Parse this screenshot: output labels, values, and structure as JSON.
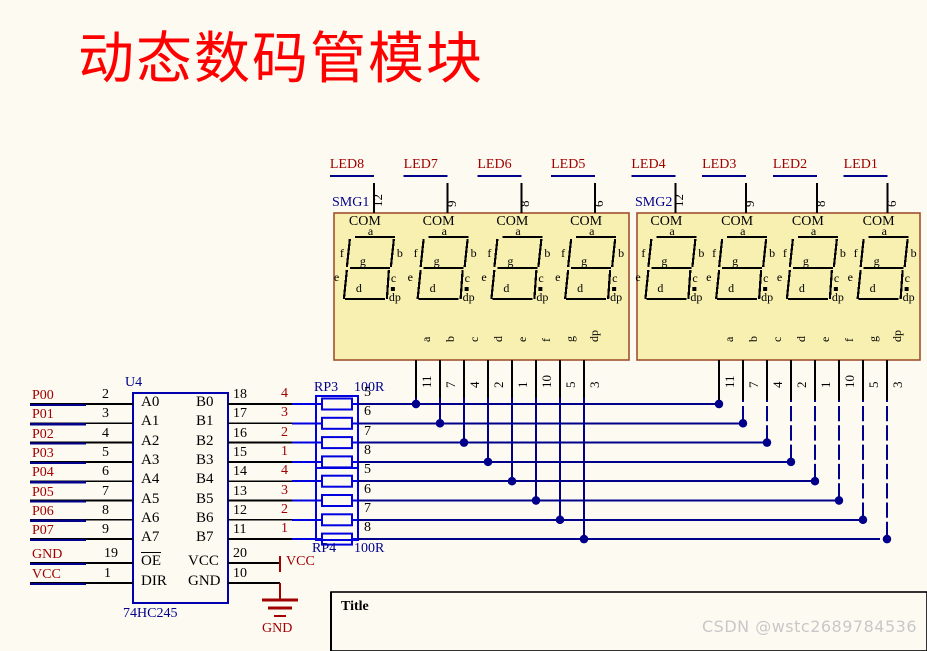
{
  "page": {
    "title_cn": "动态数码管模块",
    "watermark": "CSDN @wstc2689784536",
    "title_block_label": "Title",
    "bg_color": "#fdfaf2",
    "wire_color": "#00008b",
    "pin_line_color": "#000000",
    "label_red": "#a00000",
    "label_blue": "#00008b",
    "display_fill": "#f7f0b0",
    "display_border": "#a05030"
  },
  "displays": [
    {
      "ref": "SMG1",
      "digits": [
        {
          "led_label": "LED8",
          "com_pin": "12",
          "com_label": "COM"
        },
        {
          "led_label": "LED7",
          "com_pin": "9",
          "com_label": "COM"
        },
        {
          "led_label": "LED6",
          "com_pin": "8",
          "com_label": "COM"
        },
        {
          "led_label": "LED5",
          "com_pin": "6",
          "com_label": "COM"
        }
      ],
      "segment_labels": [
        "a",
        "b",
        "c",
        "d",
        "e",
        "f",
        "g",
        "dp"
      ],
      "segment_pins": [
        "11",
        "7",
        "4",
        "2",
        "1",
        "10",
        "5",
        "3"
      ],
      "digit_seg_names": [
        "a",
        "b",
        "c",
        "d",
        "e",
        "f",
        "g",
        "dp"
      ]
    },
    {
      "ref": "SMG2",
      "digits": [
        {
          "led_label": "LED4",
          "com_pin": "12",
          "com_label": "COM"
        },
        {
          "led_label": "LED3",
          "com_pin": "9",
          "com_label": "COM"
        },
        {
          "led_label": "LED2",
          "com_pin": "8",
          "com_label": "COM"
        },
        {
          "led_label": "LED1",
          "com_pin": "6",
          "com_label": "COM"
        }
      ],
      "segment_labels": [
        "a",
        "b",
        "c",
        "d",
        "e",
        "f",
        "g",
        "dp"
      ],
      "segment_pins": [
        "11",
        "7",
        "4",
        "2",
        "1",
        "10",
        "5",
        "3"
      ],
      "digit_seg_names": [
        "a",
        "b",
        "c",
        "d",
        "e",
        "f",
        "g",
        "dp"
      ]
    }
  ],
  "ic": {
    "ref": "U4",
    "part": "74HC245",
    "left_nets": [
      "P00",
      "P01",
      "P02",
      "P03",
      "P04",
      "P05",
      "P06",
      "P07"
    ],
    "left_pins": [
      "2",
      "3",
      "4",
      "5",
      "6",
      "7",
      "8",
      "9"
    ],
    "left_names": [
      "A0",
      "A1",
      "A2",
      "A3",
      "A4",
      "A5",
      "A6",
      "A7"
    ],
    "right_pins": [
      "18",
      "17",
      "16",
      "15",
      "14",
      "13",
      "12",
      "11"
    ],
    "right_names": [
      "B0",
      "B1",
      "B2",
      "B3",
      "B4",
      "B5",
      "B6",
      "B7"
    ],
    "power": [
      {
        "net": "GND",
        "pin": "19",
        "name": "OE",
        "overline": true
      },
      {
        "net": "VCC",
        "pin": "1",
        "name": "DIR",
        "overline": false
      }
    ],
    "power_right": [
      {
        "pin": "20",
        "name": "VCC",
        "net": "VCC"
      },
      {
        "pin": "10",
        "name": "GND",
        "net": "GND"
      }
    ]
  },
  "resistor_networks": [
    {
      "ref": "RP3",
      "value": "100R",
      "left_pins": [
        "4",
        "3",
        "2",
        "1"
      ],
      "right_pins": [
        "5",
        "6",
        "7",
        "8"
      ]
    },
    {
      "ref": "RP4",
      "value": "100R",
      "left_pins": [
        "4",
        "3",
        "2",
        "1"
      ],
      "right_pins": [
        "5",
        "6",
        "7",
        "8"
      ]
    }
  ],
  "power_symbols": [
    {
      "name": "VCC",
      "type": "vcc-symbol"
    },
    {
      "name": "GND",
      "type": "gnd-symbol"
    }
  ]
}
